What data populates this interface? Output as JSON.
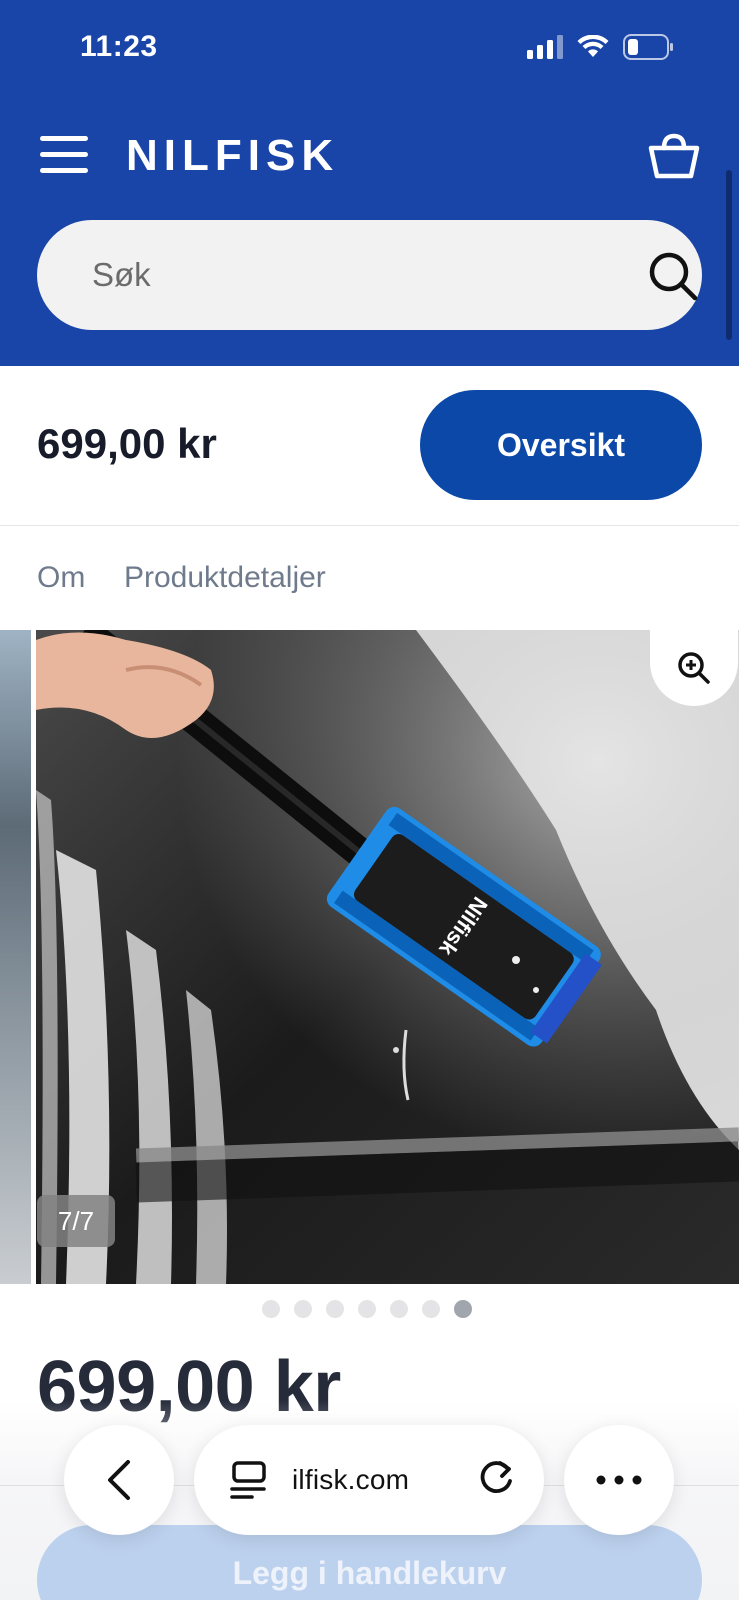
{
  "status_bar": {
    "time": "11:23"
  },
  "header": {
    "brand": "NILFISK",
    "search": {
      "placeholder": "Søk"
    }
  },
  "sticky_bar": {
    "price": "699,00 kr",
    "overview_button": "Oversikt"
  },
  "tabs": [
    "Om",
    "Produktdetaljer"
  ],
  "gallery": {
    "counter": "7/7",
    "total_images": 7,
    "active_index": 7,
    "brush_brand_text": "Nilfisk"
  },
  "product": {
    "price": "699,00 kr"
  },
  "add_to_cart": {
    "label": "Legg i handlekurv"
  },
  "browser": {
    "url_display": "ilfisk.com"
  },
  "colors": {
    "header_bg": "#1a45a8",
    "primary_button": "#0c48a8",
    "brush_blue": "#1f8de8"
  }
}
